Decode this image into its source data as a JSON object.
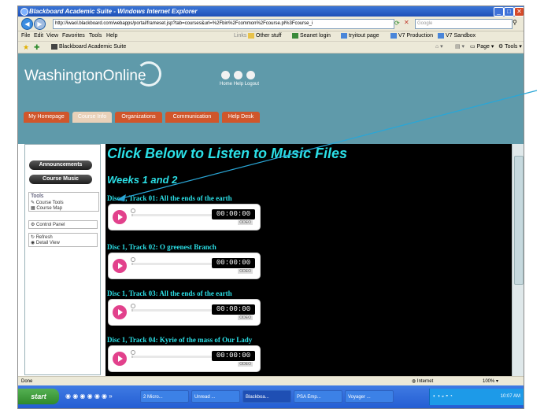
{
  "window": {
    "title": "Blackboard Academic Suite - Windows Internet Explorer",
    "min": "_",
    "max": "□",
    "close": "✕"
  },
  "address_bar": {
    "url": "http://iwaol.blackboard.com/webapps/portal/frameset.jsp?tab=courses&url=%2Fbin%2Fcommon%2Fcourse.pl%3Fcourse_i",
    "search_placeholder": "Google"
  },
  "menu": [
    "File",
    "Edit",
    "View",
    "Favorites",
    "Tools",
    "Help"
  ],
  "links_bar": {
    "label": "Links",
    "items": [
      "Other stuff",
      "Seanet login",
      "tryitout page",
      "V7 Production",
      "V7 Sandbox"
    ]
  },
  "favorites_tab": "Blackboard Academic Suite",
  "ie_toolbar": [
    "Page",
    "Tools"
  ],
  "site": {
    "logo": "WashingtonOnline",
    "top_links": [
      "Home",
      "Help",
      "Logout"
    ],
    "tabs": [
      {
        "label": "My Homepage"
      },
      {
        "label": "Course Info"
      },
      {
        "label": "Organizations"
      },
      {
        "label": "Communication"
      },
      {
        "label": "Help Desk"
      }
    ]
  },
  "sidebar": {
    "buttons": [
      "Announcements",
      "Course Music"
    ],
    "tools_header": "Tools",
    "tools_items": [
      "Course Tools",
      "Course Map"
    ],
    "control_panel": "Control Panel",
    "refresh": "Refresh",
    "detail_view": "Detail View"
  },
  "content": {
    "heading": "Click Below to Listen to Music Files",
    "subheading": "Weeks 1 and 2",
    "tracks": [
      {
        "title": "Disc 1, Track 01: All the ends of the earth",
        "time": "00:00:00",
        "brand": "ODEO"
      },
      {
        "title": "Disc 1, Track 02: O greenest Branch",
        "time": "00:00:00",
        "brand": "ODEO"
      },
      {
        "title": "Disc 1, Track 03: All the ends of the earth",
        "time": "00:00:00",
        "brand": "ODEO"
      },
      {
        "title": "Disc 1, Track 04: Kyrie of the mass of Our Lady",
        "time": "00:00:00",
        "brand": "ODEO"
      }
    ]
  },
  "status_bar": {
    "left": "Done",
    "zone": "Internet",
    "zoom": "100%"
  },
  "taskbar": {
    "start": "start",
    "items": [
      "2 Micro...",
      "Unread ...",
      "Blackboa...",
      "PSA Emp...",
      "Voyager ..."
    ],
    "clock": "10:07 AM"
  },
  "colors": {
    "accent_cyan": "#2bdfe6",
    "tab_orange": "#d0562b",
    "header_teal": "#5f9aaa",
    "play_pink": "#e2418c"
  }
}
